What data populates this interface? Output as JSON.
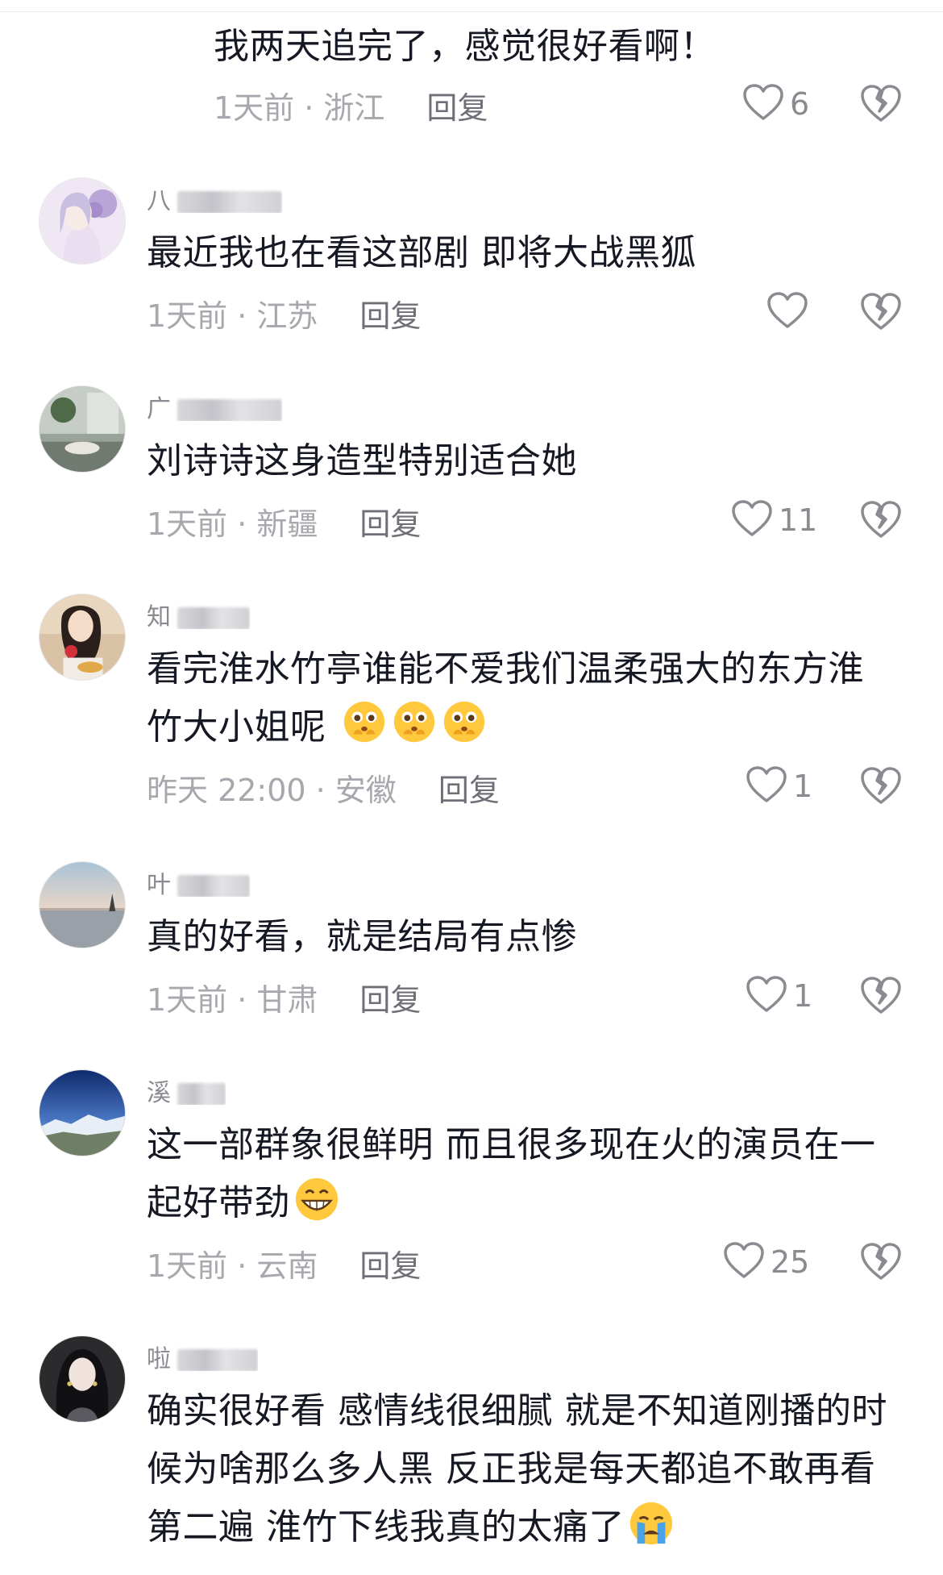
{
  "comments": [
    {
      "username": "",
      "text": "我两天追完了，感觉很好看啊！",
      "time_location": "1天前 · 浙江",
      "reply_label": "回复",
      "likes": "6"
    },
    {
      "username": "八",
      "text": "最近我也在看这部剧 即将大战黑狐",
      "time_location": "1天前 · 江苏",
      "reply_label": "回复",
      "likes": ""
    },
    {
      "username": "广",
      "text": "刘诗诗这身造型特别适合她",
      "time_location": "1天前 · 新疆",
      "reply_label": "回复",
      "likes": "11"
    },
    {
      "username": "知",
      "text": "看完淮水竹亭谁能不爱我们温柔强大的东方淮竹大小姐呢",
      "emoji": "pleading-hands-emoji",
      "emoji_count": 3,
      "time_location": "昨天 22:00 · 安徽",
      "reply_label": "回复",
      "likes": "1"
    },
    {
      "username": "叶",
      "text": "真的好看，就是结局有点惨",
      "time_location": "1天前 · 甘肃",
      "reply_label": "回复",
      "likes": "1"
    },
    {
      "username": "溪",
      "text": "这一部群象很鲜明 而且很多现在火的演员在一起好带劲",
      "emoji": "grinning-emoji",
      "emoji_count": 1,
      "time_location": "1天前 · 云南",
      "reply_label": "回复",
      "likes": "25"
    },
    {
      "username": "啦",
      "text": "确实很好看 感情线很细腻 就是不知道刚播的时候为啥那么多人黑 反正我是每天都追不敢再看第二遍 淮竹下线我真的太痛了",
      "emoji": "crying-emoji",
      "emoji_count": 1,
      "time_location": "",
      "reply_label": "",
      "likes": ""
    }
  ],
  "icons": {
    "like": "heart-outline-icon",
    "dislike": "broken-heart-icon"
  },
  "colors": {
    "text_primary": "#161823",
    "text_secondary": "#a7a8ad",
    "reply": "#6f7077",
    "icon": "#8a8b91"
  }
}
